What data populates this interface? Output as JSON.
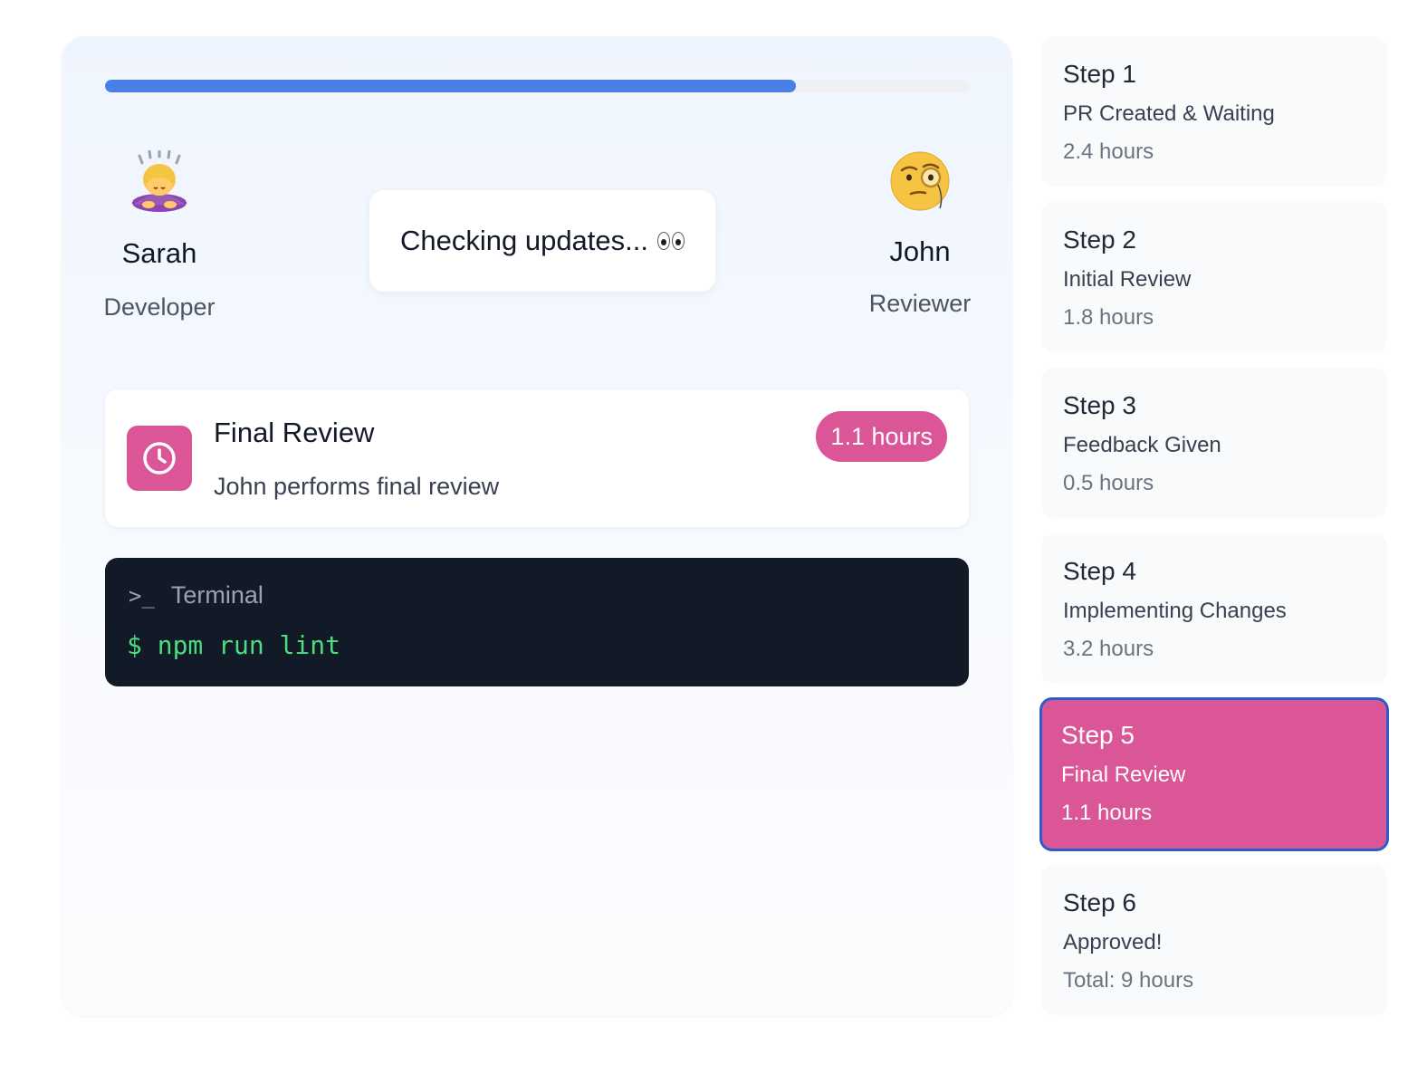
{
  "progress": {
    "percent": 80
  },
  "actors": {
    "sarah": {
      "emoji": "person-bowing-icon",
      "name": "Sarah",
      "role": "Developer"
    },
    "john": {
      "emoji": "face-with-monocle-icon",
      "name": "John",
      "role": "Reviewer"
    }
  },
  "speech_bubble": {
    "text": "Checking updates...",
    "emoji": "eyes-icon"
  },
  "current_step": {
    "icon": "clock-icon",
    "title": "Final Review",
    "description": "John performs final review",
    "duration": "1.1 hours"
  },
  "terminal": {
    "icon": "terminal-prompt-icon",
    "title": "Terminal",
    "command": "$ npm run lint"
  },
  "steps": [
    {
      "title": "Step 1",
      "label": "PR Created & Waiting",
      "time": "2.4 hours",
      "active": false
    },
    {
      "title": "Step 2",
      "label": "Initial Review",
      "time": "1.8 hours",
      "active": false
    },
    {
      "title": "Step 3",
      "label": "Feedback Given",
      "time": "0.5 hours",
      "active": false
    },
    {
      "title": "Step 4",
      "label": "Implementing Changes",
      "time": "3.2 hours",
      "active": false
    },
    {
      "title": "Step 5",
      "label": "Final Review",
      "time": "1.1 hours",
      "active": true
    },
    {
      "title": "Step 6",
      "label": "Approved!",
      "time": "Total: 9 hours",
      "active": false
    }
  ],
  "colors": {
    "accent_pink": "#db5697",
    "progress_blue": "#4a7fe8",
    "active_border": "#2b5dc8",
    "terminal_bg": "#131a27",
    "terminal_green": "#4ade80"
  }
}
